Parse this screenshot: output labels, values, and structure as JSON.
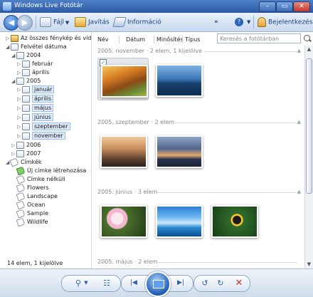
{
  "window": {
    "title": "Windows Live Fotótár"
  },
  "titlebar": {
    "minimize": "–",
    "maximize": "▭",
    "close": "✕"
  },
  "toolbar": {
    "back": "◀",
    "forward": "▶",
    "file": "Fájl",
    "fix": "Javítás",
    "info": "Információ",
    "more": "»",
    "help": "?",
    "signin": "Bejelentkezés"
  },
  "tree": {
    "all": "Az összes fénykép és videó",
    "date_taken": "Felvétel dátuma",
    "y2004": "2004",
    "feb": "február",
    "apr1": "április",
    "y2005": "2005",
    "jan": "január",
    "apr2": "április",
    "may": "május",
    "jun": "június",
    "sep": "szeptember",
    "nov": "november",
    "y2006": "2006",
    "y2007": "2007",
    "tags": "Címkék",
    "new_tag": "Új címke létrehozása",
    "untagged": "Címke nélküli",
    "flowers": "Flowers",
    "landscape": "Landscape",
    "ocean": "Ocean",
    "sample": "Sample",
    "wildlife": "Wildlife"
  },
  "status": "14 elem, 1 kijelölve",
  "columns": {
    "name": "Név",
    "date": "Dátum",
    "rating": "Minősítés",
    "type": "Típus"
  },
  "search": {
    "placeholder": "Keresés a fotótárban"
  },
  "groups": {
    "nov": "2005. november · 2 elem, 1 kijelölve",
    "sep": "2005. szeptember · 2 elem",
    "jun": "2005. június · 3 elem",
    "may": "2005. május · 2 elem"
  },
  "bottom": {
    "zoom": "⚲",
    "details": "☷",
    "prev": "|◀",
    "next": "▶|",
    "rot_left": "↺",
    "rot_right": "↻",
    "delete": "✕"
  }
}
